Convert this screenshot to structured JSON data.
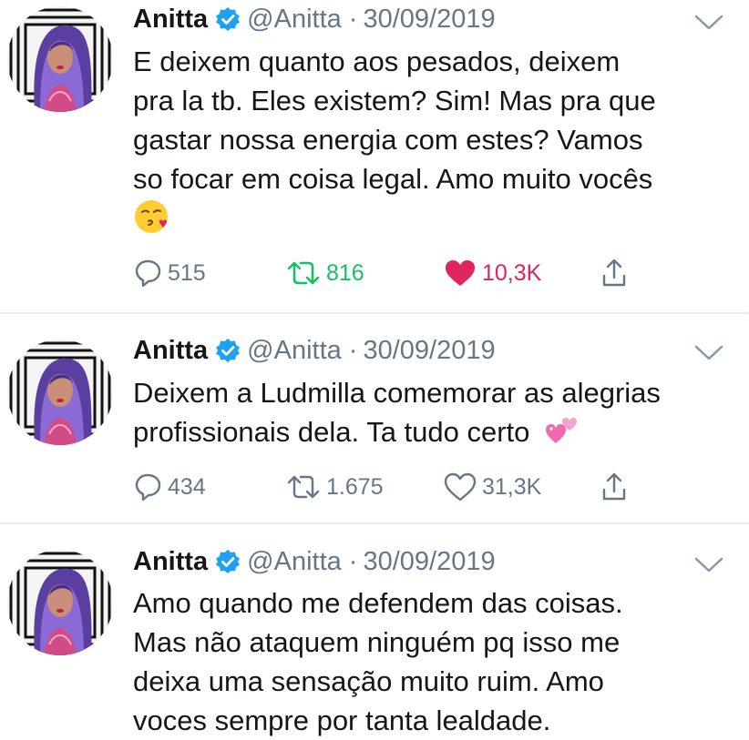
{
  "colors": {
    "text": "#14171a",
    "secondary": "#657786",
    "verified": "#1da1f2",
    "retweet_active": "#17bf63",
    "like_active": "#e0245e",
    "separator": "#e6ecf0"
  },
  "tweets": [
    {
      "name": "Anitta",
      "handle": "@Anitta",
      "sep": "·",
      "date": "30/09/2019",
      "lines": [
        "E deixem quanto aos pesados, deixem",
        "pra la tb. Eles existem? Sim! Mas pra que",
        "gastar nossa energia com estes? Vamos",
        "so focar em coisa legal. Amo muito vocês"
      ],
      "emoji": "face-blowing-kiss",
      "replies": "515",
      "retweets": "816",
      "likes": "10,3K",
      "retweeted": true,
      "liked": true
    },
    {
      "name": "Anitta",
      "handle": "@Anitta",
      "sep": "·",
      "date": "30/09/2019",
      "lines": [
        "Deixem a Ludmilla comemorar as alegrias",
        "profissionais dela. Ta tudo certo"
      ],
      "emoji": "two-hearts",
      "replies": "434",
      "retweets": "1.675",
      "likes": "31,3K",
      "retweeted": false,
      "liked": false
    },
    {
      "name": "Anitta",
      "handle": "@Anitta",
      "sep": "·",
      "date": "30/09/2019",
      "lines": [
        "Amo quando me defendem das coisas.",
        "Mas não ataquem ninguém pq isso me",
        "deixa uma sensação muito ruim. Amo",
        "voces sempre por tanta lealdade."
      ]
    }
  ]
}
